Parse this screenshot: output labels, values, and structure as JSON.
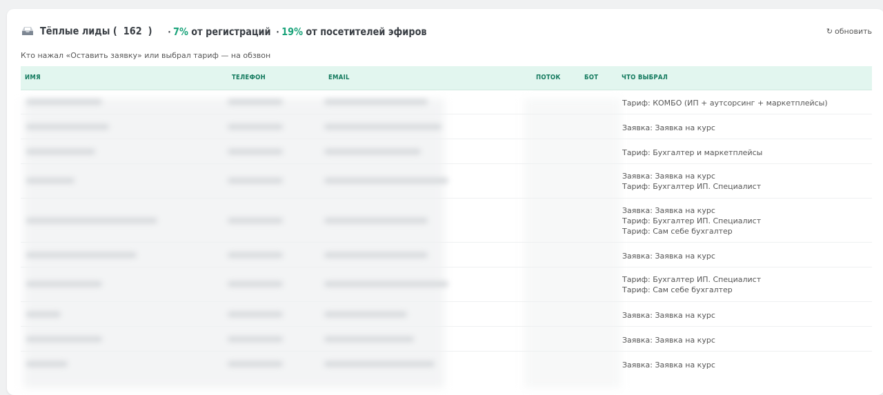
{
  "header": {
    "title_prefix": "Тёплые лиды (",
    "count": "162",
    "title_suffix": ")",
    "sep1": "·",
    "stat1_pct": "7%",
    "stat1_text": "от регистраций",
    "sep2": "·",
    "stat2_pct": "19%",
    "stat2_text": "от посетителей эфиров",
    "icon": "inbox-tray-icon"
  },
  "refresh": {
    "label": "обновить",
    "icon": "refresh-icon"
  },
  "subtitle": "Кто нажал «Оставить заявку» или выбрал тариф — на обзвон",
  "table": {
    "columns": [
      "ИМЯ",
      "ТЕЛЕФОН",
      "EMAIL",
      "ПОТОК",
      "БОТ",
      "ЧТО ВЫБРАЛ"
    ],
    "rows": [
      {
        "choice": [
          "Тариф: КОМБО (ИП + аутсорсинг + маркетплейсы)"
        ]
      },
      {
        "choice": [
          "Заявка: Заявка на курс"
        ]
      },
      {
        "choice": [
          "Тариф: Бухгалтер и маркетплейсы"
        ]
      },
      {
        "choice": [
          "Заявка: Заявка на курс",
          "Тариф: Бухгалтер ИП. Специалист"
        ]
      },
      {
        "choice": [
          "Заявка: Заявка на курс",
          "Тариф: Бухгалтер ИП. Специалист",
          "Тариф: Сам себе бухгалтер"
        ]
      },
      {
        "choice": [
          "Заявка: Заявка на курс"
        ]
      },
      {
        "choice": [
          "Тариф: Бухгалтер ИП. Специалист",
          "Тариф: Сам себе бухгалтер"
        ]
      },
      {
        "choice": [
          "Заявка: Заявка на курс"
        ]
      },
      {
        "choice": [
          "Заявка: Заявка на курс"
        ]
      },
      {
        "choice": [
          "Заявка: Заявка на курс"
        ]
      }
    ]
  },
  "colors": {
    "accent": "#1aa37a",
    "header_bg": "#e2f6ef",
    "header_text": "#137a5e"
  }
}
